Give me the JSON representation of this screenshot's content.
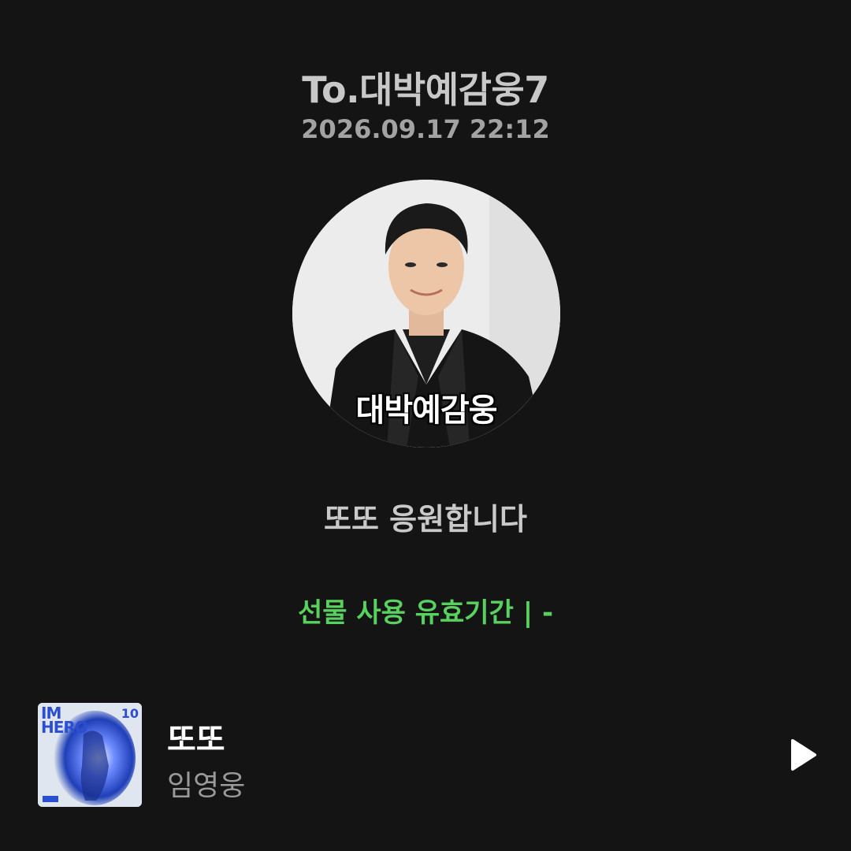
{
  "card": {
    "recipient": "To.대박예감웅7",
    "timestamp": "2026.09.17 22:12",
    "profile_caption": "대박예감웅",
    "message": "또또 응원합니다",
    "validity": "선물 사용 유효기간 |   -"
  },
  "track": {
    "title": "또또",
    "artist": "임영웅",
    "album_art_text": "IM\nHERO",
    "album_art_text_right": "10"
  },
  "colors": {
    "background": "#141414",
    "accent_green": "#58d15e"
  },
  "icons": {
    "play": "play-icon"
  }
}
